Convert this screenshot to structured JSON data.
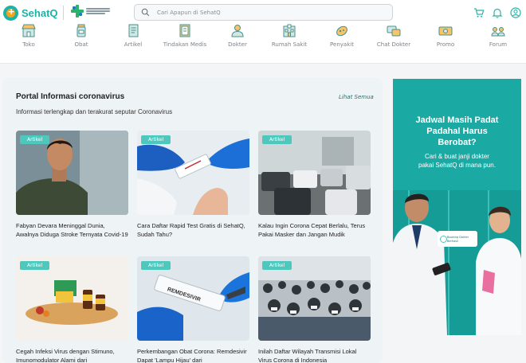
{
  "brand": {
    "name": "SehatQ",
    "partner_logo": "kemenkes-logo"
  },
  "search": {
    "placeholder": "Cari Apapun di SehatQ",
    "icon": "search-icon"
  },
  "header_icons": [
    "cart-icon",
    "bell-icon",
    "user-icon"
  ],
  "nav": [
    {
      "label": "Toko",
      "icon": "shop-icon"
    },
    {
      "label": "Obat",
      "icon": "medicine-icon"
    },
    {
      "label": "Artikel",
      "icon": "article-icon"
    },
    {
      "label": "Tindakan Medis",
      "icon": "medical-procedure-icon"
    },
    {
      "label": "Dokter",
      "icon": "doctor-icon"
    },
    {
      "label": "Rumah Sakit",
      "icon": "hospital-icon"
    },
    {
      "label": "Penyakit",
      "icon": "disease-icon"
    },
    {
      "label": "Chat Dokter",
      "icon": "chat-doctor-icon"
    },
    {
      "label": "Promo",
      "icon": "promo-icon"
    },
    {
      "label": "Forum",
      "icon": "forum-icon"
    }
  ],
  "portal": {
    "title": "Portal Informasi coronavirus",
    "see_all": "Lihat Semua",
    "subtitle": "Informasi terlengkap dan terakurat seputar Coronavirus",
    "articles": [
      {
        "badge": "Artikel",
        "title": "Fabyan Devara Meninggal Dunia, Awalnya Diduga Stroke Ternyata Covid-19",
        "image": "young-man-portrait"
      },
      {
        "badge": "Artikel",
        "title": "Cara Daftar Rapid Test Gratis di SehatQ, Sudah Tahu?",
        "image": "rapid-test-photo"
      },
      {
        "badge": "Artikel",
        "title": "Kalau Ingin Corona Cepat Berlalu, Terus Pakai Masker dan Jangan Mudik",
        "image": "traffic-jam-photo"
      },
      {
        "badge": "Artikel",
        "title": "Cegah Infeksi Virus dengan Stimuno, Imunomodulator Alami dari",
        "image": "stimuno-products-photo"
      },
      {
        "badge": "Artikel",
        "title": "Perkembangan Obat Corona: Remdesivir Dapat 'Lampu Hijau' dari",
        "image": "remdesivir-vial-photo",
        "vial_label": "REMDESIVIR"
      },
      {
        "badge": "Artikel",
        "title": "Inilah Daftar Wilayah Transmisi Lokal Virus Corona di Indonesia",
        "image": "crowd-masks-photo"
      }
    ]
  },
  "banner": {
    "headline_lines": [
      "Jadwal Masih Padat",
      "Padahal Harus",
      "Berobat?"
    ],
    "sub_lines": [
      "Cari & buat janji dokter",
      "pakai SehatQ di mana pun."
    ],
    "booking_lines": [
      "Booking Dokter",
      "Berhasil"
    ]
  },
  "colors": {
    "brand_teal": "#1ab3a8",
    "brand_orange": "#f4a31c",
    "badge": "#4ec7bc",
    "banner_bg": "#1aa9a3"
  }
}
